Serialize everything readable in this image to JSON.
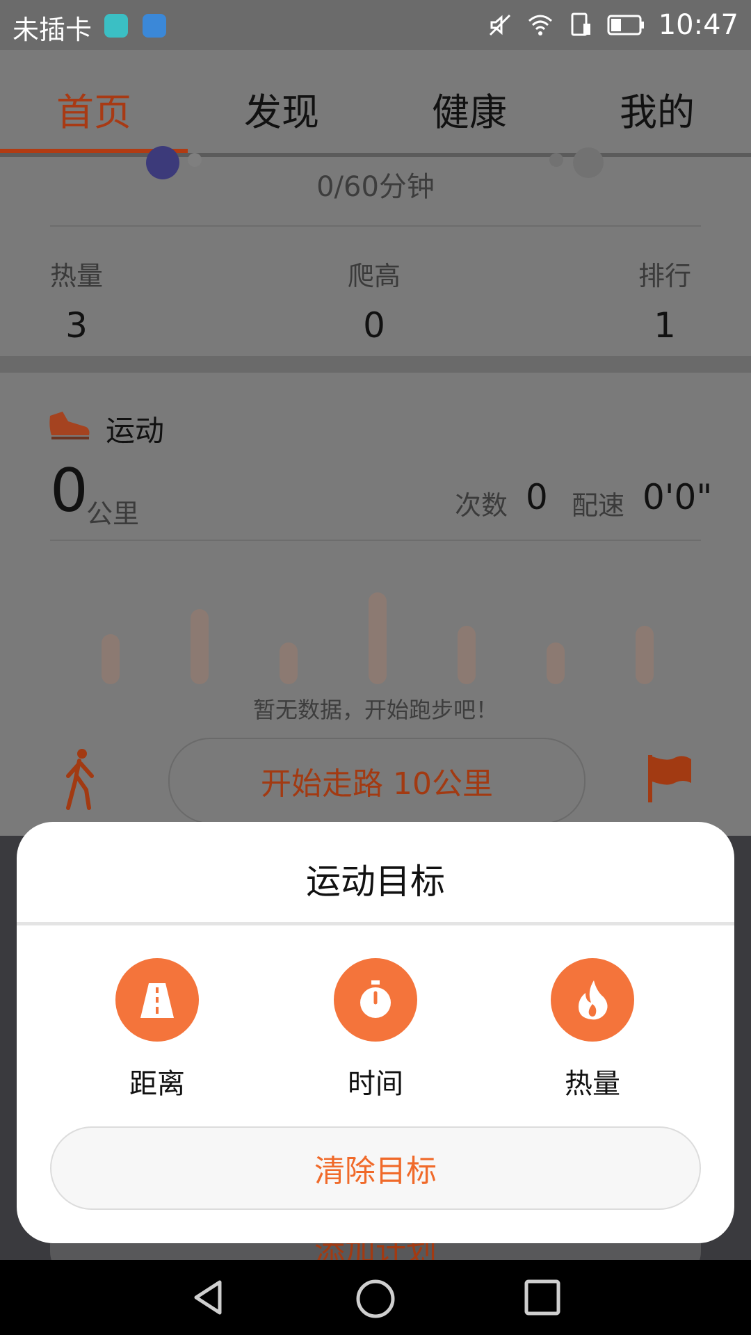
{
  "status_bar": {
    "carrier": "未插卡",
    "time": "10:47"
  },
  "tabs": [
    {
      "label": "首页",
      "active": true
    },
    {
      "label": "发现",
      "active": false
    },
    {
      "label": "健康",
      "active": false
    },
    {
      "label": "我的",
      "active": false
    }
  ],
  "activity_summary": {
    "progress_text": "0/60分钟",
    "stats": [
      {
        "label": "热量",
        "value": "3"
      },
      {
        "label": "爬高",
        "value": "0"
      },
      {
        "label": "排行",
        "value": "1"
      }
    ]
  },
  "sport_card": {
    "title": "运动",
    "distance_value": "0",
    "distance_unit": "公里",
    "count_label": "次数",
    "count_value": "0",
    "pace_label": "配速",
    "pace_value": "0'0\"",
    "empty_text": "暂无数据，开始跑步吧！",
    "start_button": "开始走路 10公里"
  },
  "hidden_button": "添加计划",
  "goal_sheet": {
    "title": "运动目标",
    "options": [
      {
        "label": "距离",
        "icon": "road-icon"
      },
      {
        "label": "时间",
        "icon": "stopwatch-icon"
      },
      {
        "label": "热量",
        "icon": "flame-icon"
      }
    ],
    "clear_button": "清除目标"
  },
  "colors": {
    "accent": "#f4743b",
    "accent_text": "#f06a2a",
    "active_tab": "#b23b12"
  }
}
